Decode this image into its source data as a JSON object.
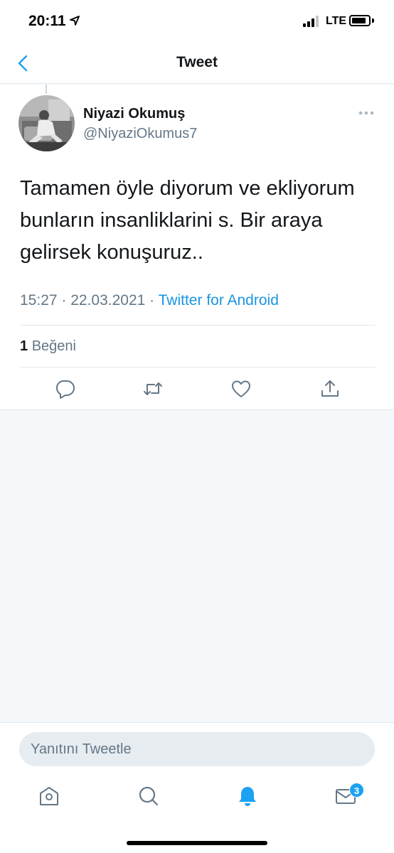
{
  "status_bar": {
    "time": "20:11",
    "network": "LTE"
  },
  "nav": {
    "title": "Tweet"
  },
  "tweet": {
    "author_name": "Niyazi Okumuş",
    "author_handle": "@NiyaziOkumus7",
    "text": "Tamamen öyle diyorum ve ekliyorum bunların insanliklarini s. Bir araya gelirsek konuşuruz..",
    "time": "15:27",
    "date": "22.03.2021",
    "source": "Twitter for Android",
    "like_count": "1",
    "like_label": "Beğeni"
  },
  "reply": {
    "placeholder": "Yanıtını Tweetle"
  },
  "tabs": {
    "messages_badge": "3"
  },
  "icons": {
    "back": "chevron-left-icon",
    "more": "more-horizontal-icon",
    "reply": "comment-icon",
    "retweet": "retweet-icon",
    "like": "heart-icon",
    "share": "share-icon",
    "home": "home-icon",
    "search": "search-icon",
    "notifications": "bell-icon",
    "messages": "mail-icon"
  },
  "colors": {
    "accent": "#1da1f2",
    "link": "#1b95e0",
    "secondary_text": "#657786",
    "primary_text": "#14171a"
  }
}
